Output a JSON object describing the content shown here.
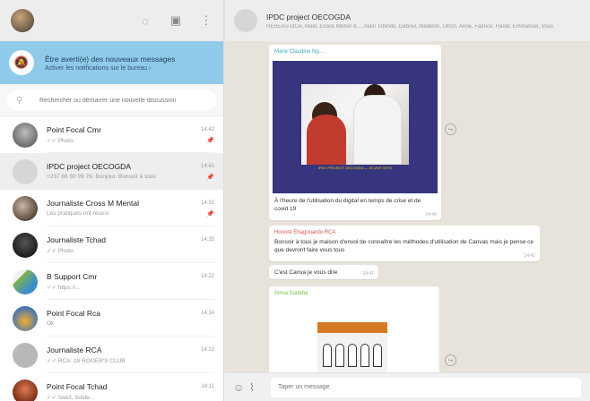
{
  "sidebar": {
    "header_icons": [
      "status-icon",
      "new-chat-icon",
      "menu-icon"
    ],
    "notification": {
      "title": "Être averti(e) des nouveaux messages",
      "subtitle": "Activer les notifications sur le bureau ›"
    },
    "search": {
      "placeholder": "Rechercher ou démarrer une nouvelle discussion"
    },
    "chats": [
      {
        "name": "Point Focal Cmr",
        "time": "14:42",
        "preview": "✓✓ Photo",
        "pinned": true,
        "avatar_color": "#8a8a8a"
      },
      {
        "name": "IPDC project OECOGDA",
        "time": "14:41",
        "preview": "+237 66 80 99 76: Bonjour. Bonsoir à tous",
        "pinned": true,
        "avatar_color": "#d6d6d6",
        "active": true
      },
      {
        "name": "Journaliste Cross M Mental",
        "time": "14:32",
        "preview": "Les pratiques ont réussi",
        "pinned": true,
        "avatar_color": "#6b5a4d"
      },
      {
        "name": "Journaliste Tchad",
        "time": "14:35",
        "preview": "✓✓ Photo",
        "pinned": false,
        "avatar_color": "#2e2e2e"
      },
      {
        "name": "B Support Cmr",
        "time": "14:22",
        "preview": "✓✓ https://...",
        "pinned": false,
        "avatar_color": "#b7cfa0"
      },
      {
        "name": "Point Focal Rca",
        "time": "14:14",
        "preview": "Ok",
        "pinned": false,
        "avatar_color": "#e6a02a"
      },
      {
        "name": "Journaliste RCA",
        "time": "14:13",
        "preview": "✓✓ RCA: 18 ROGER'S CLUB",
        "pinned": false,
        "avatar_color": "#b8b8b8"
      },
      {
        "name": "Point Focal Tchad",
        "time": "14:11",
        "preview": "✓✓ Salut, Solde...",
        "pinned": false,
        "avatar_color": "#c2552e"
      }
    ]
  },
  "conversation": {
    "title": "IPDC project OECOGDA",
    "members": "RÉSEAU-OCA, Maël, Enock Michel B..., Alain Tchindo, Gabriel, Madelon, Ulrich, Anne, Fabrice, Hanid, Emmanuel, Vous",
    "messages": [
      {
        "sender": "Marie Claudine Ng...",
        "sender_color": "#3aa8c8",
        "text": "À l'heure de l'utilisation du digital en temps de crise et de covid 19",
        "time": "14:40"
      },
      {
        "sender": "Honoré Ehagouardo RCA",
        "sender_color": "#d9534f",
        "text": "Bonsoir à tous je maison d'envoi de connaître les méthodes d'utilisation de Canvas mais je pense ce que devront faire vous tous",
        "time": "14:41"
      },
      {
        "sender": "",
        "text": "C'est Canva je vous dire",
        "time": "14:41"
      },
      {
        "sender": "Sinsa Sudeba",
        "sender_color": "#6cbf3a",
        "text": "",
        "time": ""
      }
    ],
    "image_caption": "IPDC PROJECT OECOGDA — IN UNIT WITH"
  },
  "composer": {
    "placeholder": "Taper un message"
  },
  "colors": {
    "accent_notification": "#8fcaea",
    "chat_bg": "#e7e2da"
  }
}
